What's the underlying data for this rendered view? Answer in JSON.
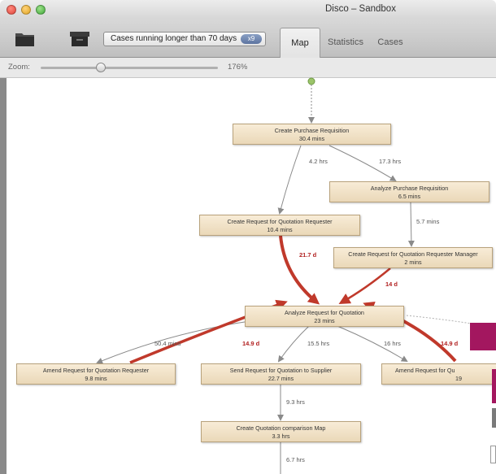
{
  "window": {
    "title": "Disco – Sandbox"
  },
  "toolbar": {
    "filter": {
      "label": "Cases running longer than 70 days",
      "badge": "x9"
    },
    "tabs": {
      "map": "Map",
      "statistics": "Statistics",
      "cases": "Cases"
    }
  },
  "zoom": {
    "label": "Zoom:",
    "value": "176%",
    "level_fraction": 0.34
  },
  "process_map": {
    "nodes": {
      "create_pr": {
        "title": "Create Purchase Requisition",
        "duration": "30.4 mins"
      },
      "analyze_pr": {
        "title": "Analyze Purchase Requisition",
        "duration": "6.5 mins"
      },
      "create_rfq_req": {
        "title": "Create Request for Quotation Requester",
        "duration": "10.4 mins"
      },
      "create_rfq_mgr": {
        "title": "Create Request for Quotation Requester Manager",
        "duration": "2 mins"
      },
      "analyze_rfq": {
        "title": "Analyze Request for Quotation",
        "duration": "23 mins"
      },
      "amend_rfq_req": {
        "title": "Amend Request for Quotation Requester",
        "duration": "9.8 mins"
      },
      "send_rfq": {
        "title": "Send Request for Quotation to Supplier",
        "duration": "22.7 mins"
      },
      "amend_rfq_partial": {
        "title": "Amend Request for Qu",
        "duration": "19"
      },
      "create_qcm": {
        "title": "Create Quotation comparison Map",
        "duration": "3.3 hrs"
      }
    },
    "edges": {
      "pr_to_rfqreq": "4.2 hrs",
      "pr_to_analyzepr": "17.3 hrs",
      "analyzepr_to_mgr": "5.7 mins",
      "rfqreq_to_analyze": "21.7 d",
      "mgr_to_analyze": "14 d",
      "analyze_to_amend": "50.4 mins",
      "amend_to_analyze": "14.9 d",
      "analyze_to_send": "15.5 hrs",
      "analyze_to_amend_right": "16 hrs",
      "amend_right_to_analyze": "14.9 d",
      "send_to_qcm": "9.3 hrs",
      "qcm_out": "6.7 hrs"
    }
  },
  "colors": {
    "node_fill": "#eedcbe",
    "edge_gray": "#8a8a8a",
    "edge_red": "#c0392b",
    "accent_magenta": "#a3175f"
  }
}
